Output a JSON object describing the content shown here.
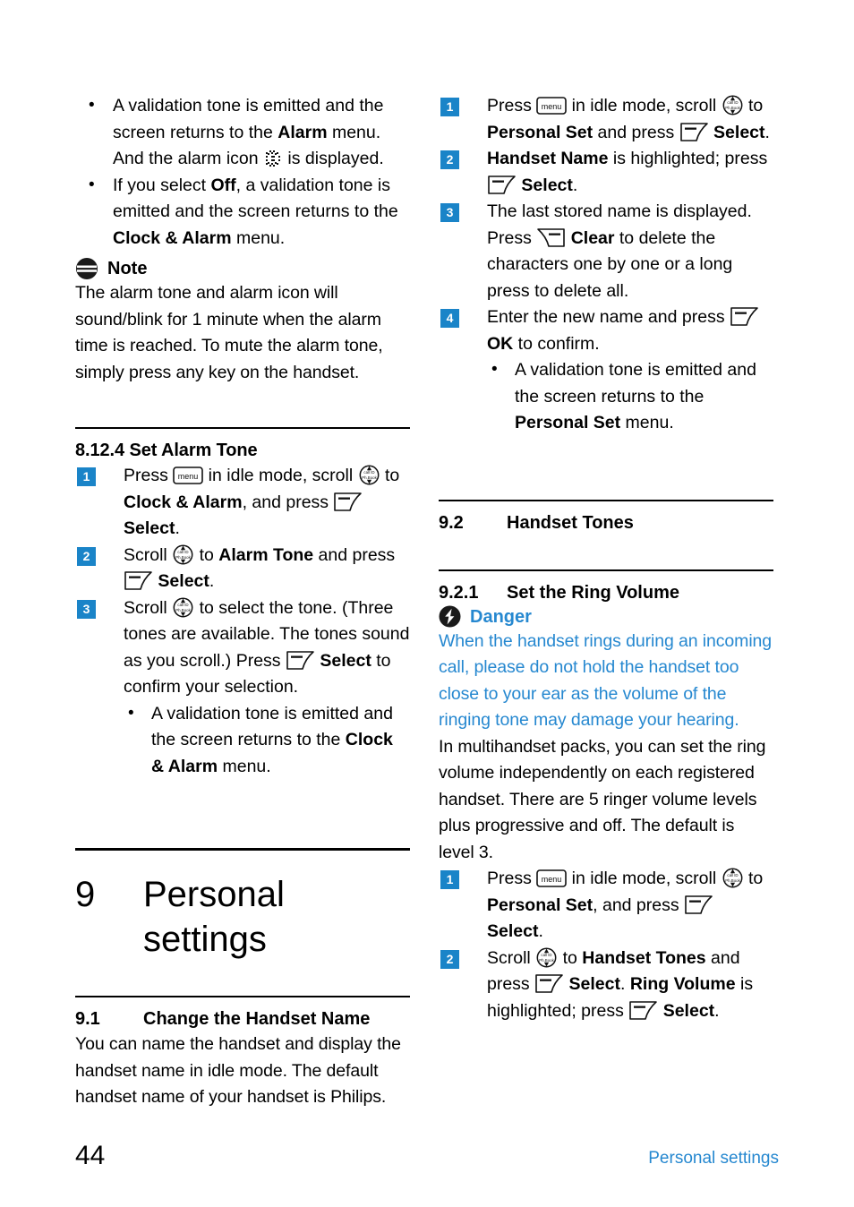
{
  "document": {
    "page_number": "44",
    "footer_label": "Personal settings",
    "accent_blue": "#2688d0",
    "badge_blue": "#1a84c8"
  },
  "left_column": {
    "top_bullets": [
      {
        "parts": [
          {
            "t": "A validation tone is emitted and the screen returns to the ",
            "s": "normal"
          },
          {
            "t": "Alarm",
            "s": "bold"
          },
          {
            "t": " menu. And the alarm icon ",
            "s": "normal"
          },
          {
            "t": "alarm-clock-icon",
            "s": "icon"
          },
          {
            "t": " is displayed.",
            "s": "normal"
          }
        ]
      },
      {
        "parts": [
          {
            "t": "If you select ",
            "s": "normal"
          },
          {
            "t": "Off",
            "s": "bold"
          },
          {
            "t": ", a validation tone is emitted and the screen returns to the ",
            "s": "normal"
          },
          {
            "t": "Clock & Alarm",
            "s": "bold"
          },
          {
            "t": " menu.",
            "s": "normal"
          }
        ]
      }
    ],
    "note": {
      "icon": "note-icon",
      "title": "Note",
      "body": "The alarm tone and alarm icon will sound/blink for 1 minute when the alarm time is reached. To mute the alarm tone, simply press any key on the handset."
    },
    "section_8124": {
      "heading": "8.12.4 Set Alarm Tone",
      "steps": [
        {
          "n": "1",
          "parts": [
            {
              "t": "Press ",
              "s": "normal"
            },
            {
              "t": "menu-key-icon",
              "s": "icon"
            },
            {
              "t": " in idle mode, scroll ",
              "s": "normal"
            },
            {
              "t": "nav-key-icon",
              "s": "icon"
            },
            {
              "t": " to ",
              "s": "normal"
            },
            {
              "t": "Clock & Alarm",
              "s": "bold"
            },
            {
              "t": ", and press ",
              "s": "normal"
            },
            {
              "t": "left-softkey-icon",
              "s": "icon"
            },
            {
              "t": " ",
              "s": "normal"
            },
            {
              "t": "Select",
              "s": "bold"
            },
            {
              "t": ".",
              "s": "normal"
            }
          ]
        },
        {
          "n": "2",
          "parts": [
            {
              "t": "Scroll ",
              "s": "normal"
            },
            {
              "t": "nav-key-icon",
              "s": "icon"
            },
            {
              "t": " to ",
              "s": "normal"
            },
            {
              "t": "Alarm Tone",
              "s": "bold"
            },
            {
              "t": " and press ",
              "s": "normal"
            },
            {
              "t": "left-softkey-icon",
              "s": "icon"
            },
            {
              "t": " ",
              "s": "normal"
            },
            {
              "t": "Select",
              "s": "bold"
            },
            {
              "t": ".",
              "s": "normal"
            }
          ]
        },
        {
          "n": "3",
          "parts": [
            {
              "t": "Scroll ",
              "s": "normal"
            },
            {
              "t": "nav-key-icon",
              "s": "icon"
            },
            {
              "t": " to select the tone. (Three tones are available. The tones sound as you scroll.) Press ",
              "s": "normal"
            },
            {
              "t": "left-softkey-icon",
              "s": "icon"
            },
            {
              "t": " ",
              "s": "normal"
            },
            {
              "t": "Select",
              "s": "bold"
            },
            {
              "t": " to confirm your selection.",
              "s": "normal"
            }
          ],
          "sub_bullets": [
            {
              "parts": [
                {
                  "t": "A validation tone is emitted and the screen returns to the ",
                  "s": "normal"
                },
                {
                  "t": "Clock & Alarm",
                  "s": "bold"
                },
                {
                  "t": " menu.",
                  "s": "normal"
                }
              ]
            }
          ]
        }
      ]
    },
    "chapter": {
      "number": "9",
      "title": "Personal settings"
    },
    "section_91": {
      "number": "9.1",
      "title": "Change the Handset Name",
      "body": "You can name the handset and display the handset name in idle mode. The default handset name of your handset is Philips."
    }
  },
  "right_column": {
    "steps_handset_name": [
      {
        "n": "1",
        "parts": [
          {
            "t": "Press ",
            "s": "normal"
          },
          {
            "t": "menu-key-icon",
            "s": "icon"
          },
          {
            "t": " in idle mode, scroll ",
            "s": "normal"
          },
          {
            "t": "nav-key-icon",
            "s": "icon"
          },
          {
            "t": " to ",
            "s": "normal"
          },
          {
            "t": "Personal Set",
            "s": "bold"
          },
          {
            "t": " and press ",
            "s": "normal"
          },
          {
            "t": "left-softkey-icon",
            "s": "icon"
          },
          {
            "t": " ",
            "s": "normal"
          },
          {
            "t": "Select",
            "s": "bold"
          },
          {
            "t": ".",
            "s": "normal"
          }
        ]
      },
      {
        "n": "2",
        "parts": [
          {
            "t": "Handset Name",
            "s": "bold"
          },
          {
            "t": " is highlighted; press ",
            "s": "normal"
          },
          {
            "t": "left-softkey-icon",
            "s": "icon"
          },
          {
            "t": " ",
            "s": "normal"
          },
          {
            "t": "Select",
            "s": "bold"
          },
          {
            "t": ".",
            "s": "normal"
          }
        ]
      },
      {
        "n": "3",
        "parts": [
          {
            "t": "The last stored name is displayed. Press ",
            "s": "normal"
          },
          {
            "t": "right-softkey-icon",
            "s": "icon"
          },
          {
            "t": " ",
            "s": "normal"
          },
          {
            "t": "Clear",
            "s": "bold"
          },
          {
            "t": " to delete the characters one by one or a long press to delete all.",
            "s": "normal"
          }
        ]
      },
      {
        "n": "4",
        "parts": [
          {
            "t": "Enter the new name and press ",
            "s": "normal"
          },
          {
            "t": "left-softkey-icon",
            "s": "icon"
          },
          {
            "t": " ",
            "s": "normal"
          },
          {
            "t": "OK",
            "s": "bold"
          },
          {
            "t": " to confirm.",
            "s": "normal"
          }
        ],
        "sub_bullets": [
          {
            "parts": [
              {
                "t": "A validation tone is emitted and the screen returns to the ",
                "s": "normal"
              },
              {
                "t": "Personal Set",
                "s": "bold"
              },
              {
                "t": " menu.",
                "s": "normal"
              }
            ]
          }
        ]
      }
    ],
    "section_92": {
      "number": "9.2",
      "title": "Handset Tones"
    },
    "section_921": {
      "number": "9.2.1",
      "title": "Set the Ring Volume"
    },
    "danger": {
      "icon": "danger-icon",
      "title": "Danger",
      "body": "When the handset rings during an incoming call, please do not hold the handset too close to your ear as the volume of the ringing tone may damage your hearing."
    },
    "ring_volume_body": "In multihandset packs, you can set the ring volume independently on each registered handset. There are 5 ringer volume levels plus progressive and off. The default is level 3.",
    "steps_ring_volume": [
      {
        "n": "1",
        "parts": [
          {
            "t": "Press ",
            "s": "normal"
          },
          {
            "t": "menu-key-icon",
            "s": "icon"
          },
          {
            "t": " in idle mode, scroll ",
            "s": "normal"
          },
          {
            "t": "nav-key-icon",
            "s": "icon"
          },
          {
            "t": " to ",
            "s": "normal"
          },
          {
            "t": "Personal Set",
            "s": "bold"
          },
          {
            "t": ", and press ",
            "s": "normal"
          },
          {
            "t": "left-softkey-icon",
            "s": "icon"
          },
          {
            "t": " ",
            "s": "normal"
          },
          {
            "t": "Select",
            "s": "bold"
          },
          {
            "t": ".",
            "s": "normal"
          }
        ]
      },
      {
        "n": "2",
        "parts": [
          {
            "t": "Scroll ",
            "s": "normal"
          },
          {
            "t": "nav-key-icon",
            "s": "icon"
          },
          {
            "t": " to ",
            "s": "normal"
          },
          {
            "t": "Handset Tones",
            "s": "bold"
          },
          {
            "t": " and press ",
            "s": "normal"
          },
          {
            "t": "left-softkey-icon",
            "s": "icon"
          },
          {
            "t": " ",
            "s": "normal"
          },
          {
            "t": "Select",
            "s": "bold"
          },
          {
            "t": ". ",
            "s": "normal"
          },
          {
            "t": "Ring Volume",
            "s": "bold"
          },
          {
            "t": " is highlighted; press ",
            "s": "normal"
          },
          {
            "t": "left-softkey-icon",
            "s": "icon"
          },
          {
            "t": " ",
            "s": "normal"
          },
          {
            "t": "Select",
            "s": "bold"
          },
          {
            "t": ".",
            "s": "normal"
          }
        ]
      }
    ]
  }
}
